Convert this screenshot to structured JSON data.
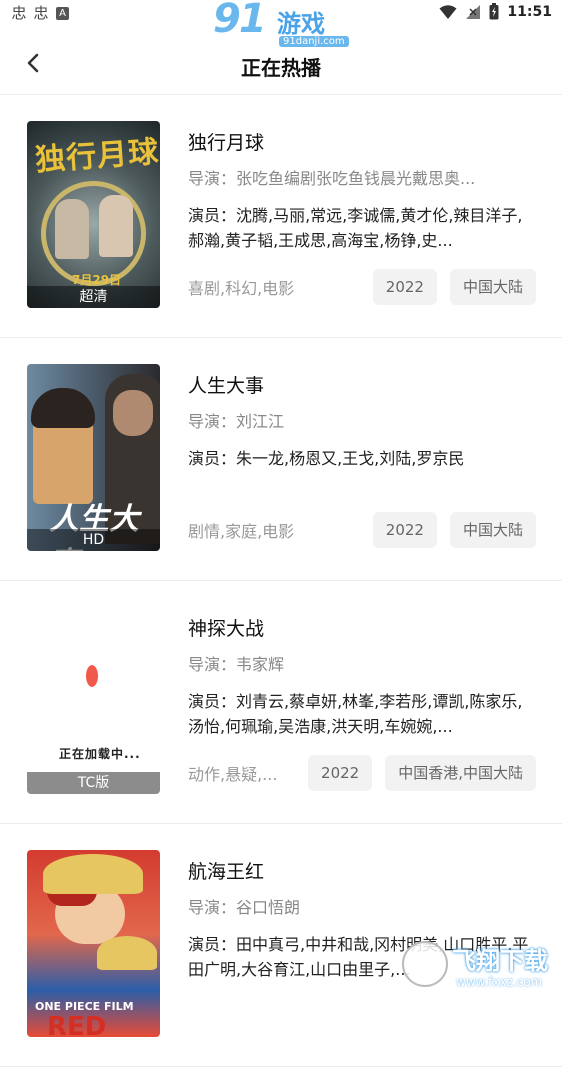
{
  "status_bar": {
    "left_glyphs": [
      "忠",
      "忠"
    ],
    "a_badge": "A",
    "time": "11:51"
  },
  "watermark_top": {
    "brand": "91",
    "game": "游戏",
    "url": "91danji.com"
  },
  "header": {
    "title": "正在热播"
  },
  "movies": [
    {
      "title": "独行月球",
      "director": "导演：张吃鱼编剧张吃鱼钱晨光戴思奥...",
      "cast": "演员：沈腾,马丽,常远,李诚儒,黄才伦,辣目洋子,郝瀚,黄子韬,王成思,高海宝,杨铮,史...",
      "genre": "喜剧,科幻,电影",
      "year": "2022",
      "region": "中国大陆",
      "quality": "超清",
      "poster_text": "独行月球",
      "poster_date": "7月29日"
    },
    {
      "title": "人生大事",
      "director": "导演：刘江江",
      "cast": "演员：朱一龙,杨恩又,王戈,刘陆,罗京民",
      "genre": "剧情,家庭,电影",
      "year": "2022",
      "region": "中国大陆",
      "quality": "HD",
      "poster_text": "人生大事"
    },
    {
      "title": "神探大战",
      "director": "导演：韦家辉",
      "cast": "演员：刘青云,蔡卓妍,林峯,李若彤,谭凯,陈家乐,汤怡,何珮瑜,吴浩康,洪天明,车婉婉,...",
      "genre": "动作,悬疑,...",
      "year": "2022",
      "region": "中国香港,中国大陆",
      "quality": "TC版",
      "poster_text": "正在加载中..."
    },
    {
      "title": "航海王红",
      "director": "导演：谷口悟朗",
      "cast": "演员：田中真弓,中井和哉,冈村明美,山口胜平,平田广明,大谷育江,山口由里子,...",
      "genre": "",
      "year": "",
      "region": "",
      "quality": "",
      "poster_text": "RED",
      "poster_sub": "ONE PIECE FILM"
    }
  ],
  "watermark_bottom": {
    "text": "飞翔下载",
    "url": "www.fxxz.com"
  }
}
